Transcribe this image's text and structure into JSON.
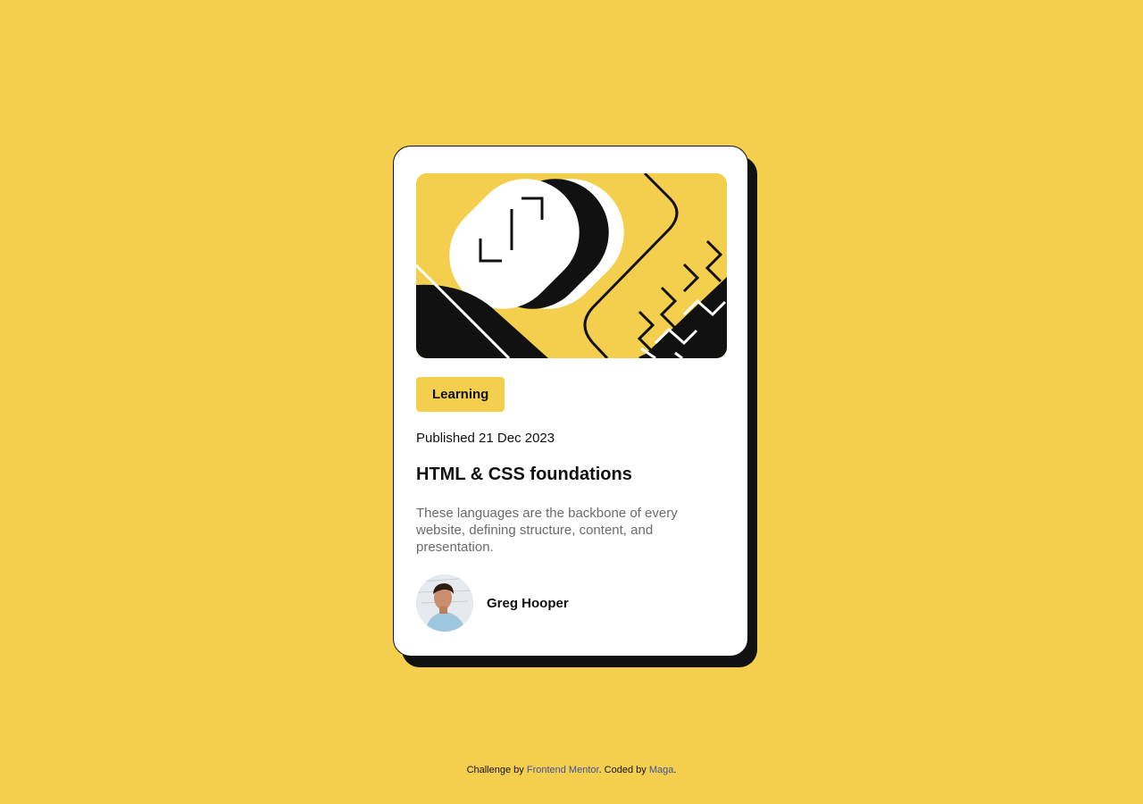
{
  "card": {
    "tag": "Learning",
    "published": "Published 21 Dec 2023",
    "title": "HTML & CSS foundations",
    "excerpt": "These languages are the backbone of every website, defining structure, content, and presentation.",
    "author": {
      "name": "Greg Hooper"
    }
  },
  "footer": {
    "prefix": "Challenge by ",
    "mentor_link": "Frontend Mentor",
    "middle": ". Coded by ",
    "coder_link": "Maga",
    "suffix": "."
  },
  "icons": {
    "hero": "abstract-illustration",
    "avatar": "person-photo"
  },
  "colors": {
    "background": "#F4CF4D",
    "card": "#FFFFFF",
    "ink": "#111111",
    "muted": "#6B6B6B",
    "link": "#3E52A3"
  }
}
